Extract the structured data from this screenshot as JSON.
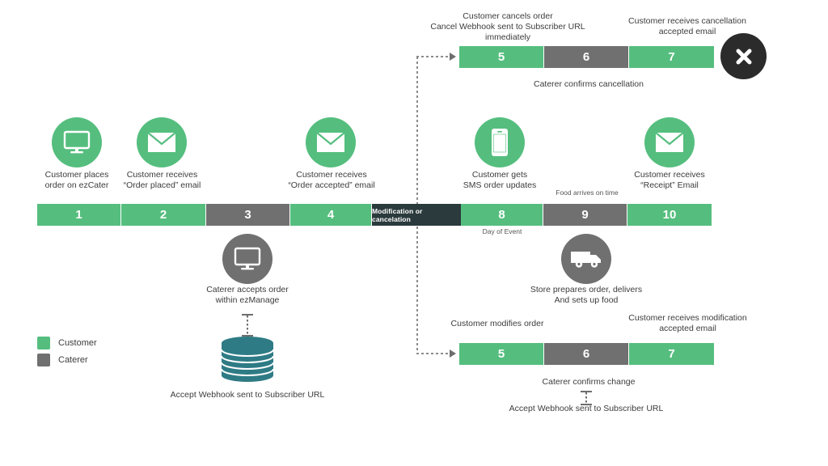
{
  "legend": {
    "items": [
      {
        "label": "Customer",
        "color": "#55be7e",
        "icon": "square-swatch"
      },
      {
        "label": "Caterer",
        "color": "#707070",
        "icon": "square-swatch"
      }
    ]
  },
  "colors": {
    "customer_green": "#55be7e",
    "caterer_gray": "#707070",
    "modification_dark": "#2b3a3c",
    "database_teal": "#2e7b85",
    "close_badge": "#2b2b2b"
  },
  "main_timeline": {
    "segments": [
      {
        "number": "1",
        "role": "customer"
      },
      {
        "number": "2",
        "role": "customer"
      },
      {
        "number": "3",
        "role": "caterer"
      },
      {
        "number": "4",
        "role": "customer"
      },
      {
        "number": "8",
        "role": "customer"
      },
      {
        "number": "9",
        "role": "caterer"
      },
      {
        "number": "10",
        "role": "customer"
      }
    ],
    "modification_block_label": "Modification or cancelation",
    "above_captions": [
      "Customer places\norder on ezCater",
      "Customer receives\n“Order placed” email",
      "Customer receives\n“Order accepted” email",
      "Customer gets\nSMS order updates",
      "Customer receives\n“Receipt” Email"
    ],
    "food_arrives_label": "Food arrives on time",
    "day_of_event_label": "Day of Event",
    "below_captions": [
      "Caterer accepts order\nwithin ezManage",
      "Store prepares order, delivers\nAnd sets up food"
    ],
    "accept_webhook_label": "Accept Webhook sent to Subscriber URL",
    "icons": [
      {
        "name": "desktop-monitor-icon",
        "role": "customer"
      },
      {
        "name": "envelope-icon",
        "role": "customer"
      },
      {
        "name": "envelope-icon",
        "role": "customer"
      },
      {
        "name": "mobile-phone-icon",
        "role": "customer"
      },
      {
        "name": "envelope-icon",
        "role": "customer"
      },
      {
        "name": "desktop-monitor-icon",
        "role": "caterer"
      },
      {
        "name": "delivery-van-icon",
        "role": "caterer"
      },
      {
        "name": "database-icon",
        "role": "system"
      }
    ]
  },
  "cancellation_branch": {
    "segments": [
      {
        "number": "5",
        "role": "customer"
      },
      {
        "number": "6",
        "role": "caterer"
      },
      {
        "number": "7",
        "role": "customer"
      }
    ],
    "caption_5": "Customer cancels order\nCancel Webhook sent to Subscriber URL immediately",
    "caption_7": "Customer receives cancellation\naccepted email",
    "caption_6_below": "Caterer confirms cancellation"
  },
  "modification_branch": {
    "segments": [
      {
        "number": "5",
        "role": "customer"
      },
      {
        "number": "6",
        "role": "caterer"
      },
      {
        "number": "7",
        "role": "customer"
      }
    ],
    "caption_5": "Customer modifies  order",
    "caption_7": "Customer receives modification\naccepted email",
    "caption_6_below": "Caterer confirms change",
    "webhook_label": "Accept Webhook sent to Subscriber URL"
  },
  "close_badge": {
    "icon": "close-x-icon"
  }
}
